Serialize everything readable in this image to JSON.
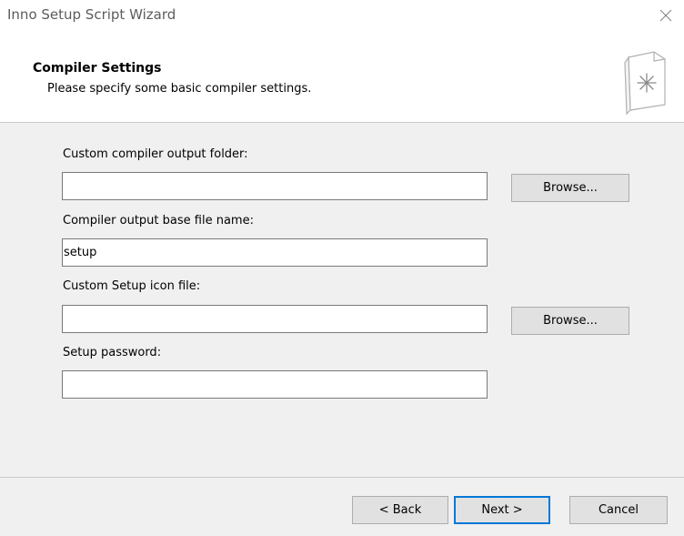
{
  "window": {
    "title": "Inno Setup Script Wizard"
  },
  "header": {
    "title": "Compiler Settings",
    "subtitle": "Please specify some basic compiler settings."
  },
  "icons": {
    "close": "close-icon",
    "wizard": "document-star-icon"
  },
  "fields": {
    "output_folder": {
      "label": "Custom compiler output folder:",
      "value": ""
    },
    "base_file_name": {
      "label": "Compiler output base file name:",
      "value": "setup"
    },
    "icon_file": {
      "label": "Custom Setup icon file:",
      "value": ""
    },
    "password": {
      "label": "Setup password:",
      "value": ""
    }
  },
  "buttons": {
    "browse_label": "Browse...",
    "back_label": "< Back",
    "next_label": "Next >",
    "cancel_label": "Cancel"
  },
  "colors": {
    "default_button_border": "#0078d7",
    "button_face": "#e1e1e1",
    "dialog_background": "#f0f0f0"
  }
}
